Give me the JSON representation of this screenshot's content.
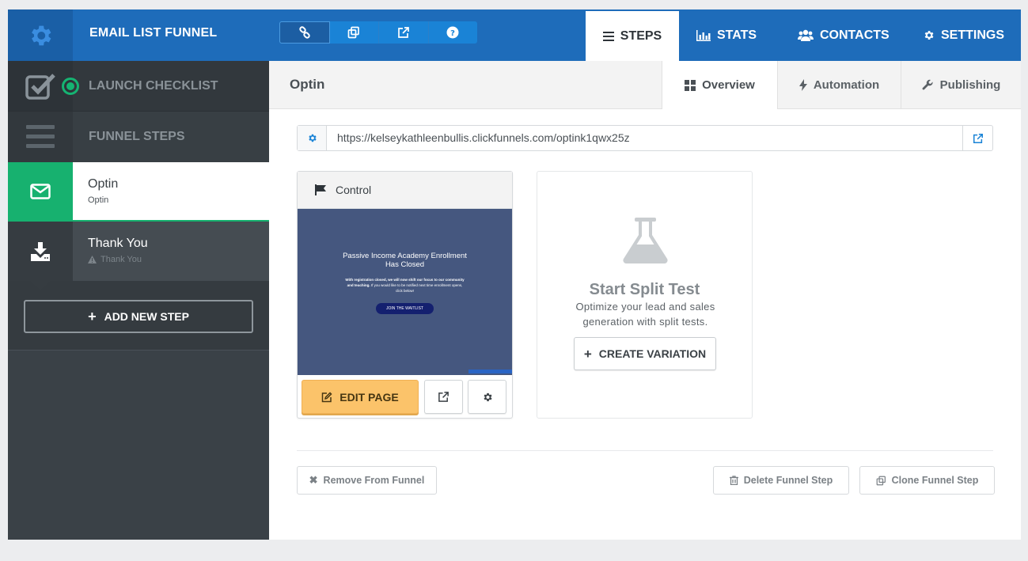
{
  "header": {
    "funnel_title": "EMAIL LIST FUNNEL",
    "settings_icon": "gear-icon",
    "tools": [
      {
        "icon": "link-icon"
      },
      {
        "icon": "copy-icon"
      },
      {
        "icon": "external-link-icon"
      },
      {
        "icon": "help-icon"
      }
    ],
    "nav": {
      "steps": "STEPS",
      "stats": "STATS",
      "contacts": "CONTACTS",
      "settings": "SETTINGS"
    }
  },
  "sidebar": {
    "launch_checklist": "LAUNCH CHECKLIST",
    "funnel_steps": "FUNNEL STEPS",
    "steps": [
      {
        "name": "Optin",
        "sub": "Optin",
        "icon": "envelope-icon"
      },
      {
        "name": "Thank You",
        "sub": "Thank You",
        "icon": "download-icon"
      }
    ],
    "add_step": "ADD NEW STEP"
  },
  "main": {
    "page_title": "Optin",
    "tabs": {
      "overview": "Overview",
      "automation": "Automation",
      "publishing": "Publishing"
    },
    "url": "https://kelseykathleenbullis.clickfunnels.com/optink1qwx25z",
    "control": {
      "label": "Control",
      "preview": {
        "title_line1": "Passive Income Academy Enrollment",
        "title_line2": "Has Closed",
        "body_bold": "With registration closed, we will now shift our focus to our community and teaching.",
        "body_rest": "If you would like to be notified next time enrollment opens, click below!",
        "button": "JOIN THE WAITLIST"
      },
      "edit_button": "EDIT PAGE"
    },
    "split_test": {
      "title": "Start Split Test",
      "description": "Optimize your lead and sales generation with split tests.",
      "button": "CREATE VARIATION"
    },
    "footer": {
      "remove": "Remove From Funnel",
      "delete": "Delete Funnel Step",
      "clone": "Clone Funnel Step"
    }
  },
  "colors": {
    "topbar": "#1e6cba",
    "accent_green": "#17b16f",
    "edit_yellow": "#fbc36a",
    "sidebar_dark": "#3a4147"
  }
}
